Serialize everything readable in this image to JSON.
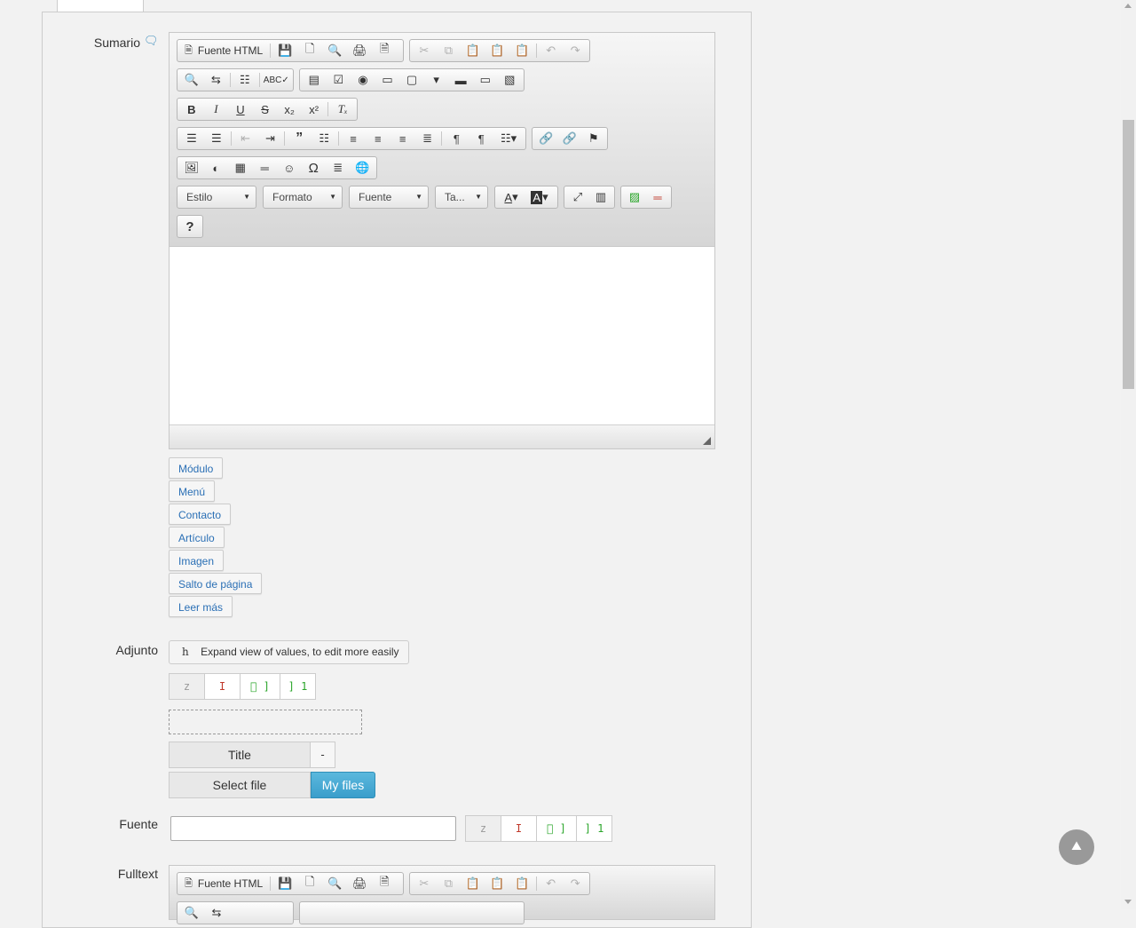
{
  "labels": {
    "summary": "Sumario",
    "attachment": "Adjunto",
    "source": "Fuente",
    "fulltext": "Fulltext"
  },
  "toolbar": {
    "source_html": "Fuente HTML",
    "combo_style": "Estilo",
    "combo_format": "Formato",
    "combo_font": "Fuente",
    "combo_size": "Ta...",
    "help": "?"
  },
  "xtd_buttons": [
    "Módulo",
    "Menú",
    "Contacto",
    "Artículo",
    "Imagen",
    "Salto de página",
    "Leer más"
  ],
  "attachment": {
    "expand_icon": "h",
    "expand_label": "Expand view of values, to edit more easily",
    "title_label": "Title",
    "title_sep": "-",
    "select_file": "Select file",
    "my_files": "My files"
  },
  "mini_buttons": [
    "z",
    "I",
    "\u0000 ]",
    "] 1"
  ],
  "source_input": {
    "value": ""
  },
  "colors": {
    "link": "#2a6fb5",
    "primary": "#3a9ecb"
  },
  "icons": {
    "comment": "comment-icon",
    "scroll_top": "chevron-up-icon"
  }
}
